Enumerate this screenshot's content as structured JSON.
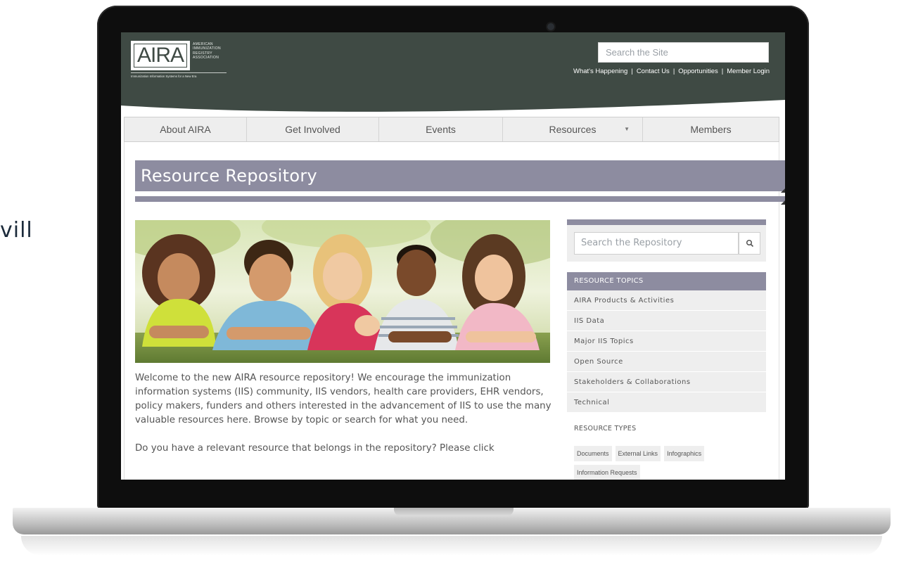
{
  "background_text": "vill",
  "site": {
    "logo": {
      "word": "AIRA",
      "sub_lines": [
        "AMERICAN",
        "IMMUNIZATION",
        "REGISTRY",
        "ASSOCIATION"
      ],
      "tagline": "Immunization Information Systems for a New Era"
    },
    "search_placeholder": "Search the Site",
    "utility_links": [
      "What's Happening",
      "Contact Us",
      "Opportunities",
      "Member Login"
    ],
    "nav": [
      {
        "label": "About AIRA"
      },
      {
        "label": "Get Involved"
      },
      {
        "label": "Events"
      },
      {
        "label": "Resources",
        "has_dropdown": true
      },
      {
        "label": "Members"
      }
    ],
    "page_title": "Resource Repository",
    "intro_paragraphs": [
      "Welcome to the new AIRA resource repository! We encourage the immunization information systems (IIS) community, IIS vendors, health care providers, EHR vendors, policy makers, funders and others interested in the advancement of IIS to use the many valuable resources here. Browse by topic or search for what you need.",
      "Do you have a relevant resource that belongs in the repository? Please click"
    ],
    "sidebar": {
      "search_placeholder": "Search the Repository",
      "topics_header": "RESOURCE TOPICS",
      "topics": [
        "AIRA Products & Activities",
        "IIS Data",
        "Major IIS Topics",
        "Open Source",
        "Stakeholders & Collaborations",
        "Technical"
      ],
      "types_header": "RESOURCE TYPES",
      "types": [
        "Documents",
        "External Links",
        "Infographics",
        "Information Requests"
      ]
    }
  },
  "colors": {
    "header_bg": "#3f4a44",
    "accent_purple": "#8d8ca0",
    "sidebar_bg": "#eeeeee",
    "body_text": "#555555"
  }
}
